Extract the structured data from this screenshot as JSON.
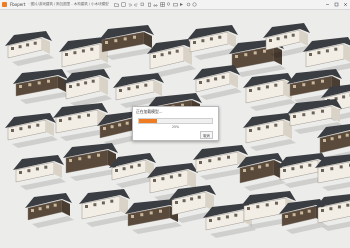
{
  "titlebar": {
    "app_name": "Fbxpert",
    "doc_title": "· 图片/游戏建筑 / 斯瓦图里 - 木构建筑 / 小木块模型",
    "toolbar_icons": [
      "open-icon",
      "save-icon",
      "undo-icon",
      "redo-icon",
      "copy-icon",
      "paste-icon",
      "cut-icon",
      "grid-icon",
      "light-icon",
      "camera-icon",
      "render-icon",
      "settings-icon",
      "help-icon"
    ],
    "window_controls": [
      "minimize-icon",
      "maximize-icon",
      "close-icon"
    ]
  },
  "dialog": {
    "title": "正在加载模型...",
    "progress_percent": 25,
    "percent_label": "25%",
    "cancel_label": "取消"
  },
  "colors": {
    "accent": "#f07c22",
    "roof": "#3a3d42",
    "wall_light": "#f2eee6",
    "wall_dark": "#5a4a3c",
    "ground": "#ececea"
  }
}
